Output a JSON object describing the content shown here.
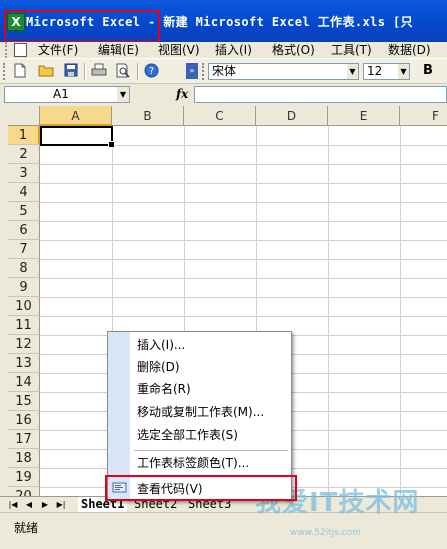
{
  "window": {
    "title": "Microsoft Excel - 新建 Microsoft Excel 工作表.xls  [只",
    "app_icon_glyph": "X"
  },
  "menubar": {
    "items": [
      "文件(F)",
      "编辑(E)",
      "视图(V)",
      "插入(I)",
      "格式(O)",
      "工具(T)",
      "数据(D)"
    ]
  },
  "toolbar": {
    "font_name": "宋体",
    "font_size": "12",
    "bold_label": "B"
  },
  "formula_bar": {
    "cell_ref": "A1",
    "fx_label": "fx",
    "formula": ""
  },
  "grid": {
    "columns": [
      "A",
      "B",
      "C",
      "D",
      "E",
      "F"
    ],
    "rows": [
      "1",
      "2",
      "3",
      "4",
      "5",
      "6",
      "7",
      "8",
      "9",
      "10",
      "11",
      "12",
      "13",
      "14",
      "15",
      "16",
      "17",
      "18",
      "19",
      "20"
    ],
    "active_column": "A",
    "active_row": "1"
  },
  "sheet_tabs": {
    "tabs": [
      "Sheet1",
      "Sheet2",
      "Sheet3"
    ],
    "active": "Sheet1"
  },
  "context_menu": {
    "items": [
      {
        "label": "插入(I)..."
      },
      {
        "label": "删除(D)"
      },
      {
        "label": "重命名(R)"
      },
      {
        "label": "移动或复制工作表(M)..."
      },
      {
        "label": "选定全部工作表(S)"
      },
      {
        "label": "工作表标签颜色(T)..."
      },
      {
        "label": "查看代码(V)"
      }
    ],
    "highlighted_index": 6
  },
  "statusbar": {
    "text": "就绪"
  },
  "watermark": {
    "main": "我爱IT技术网",
    "sub": "www.52itjs.com"
  },
  "colors": {
    "title_bar": "#0a58e0",
    "highlight_box": "#e4001a",
    "active_header": "#f8d88a",
    "menu_gutter": "#d8e6f8"
  }
}
